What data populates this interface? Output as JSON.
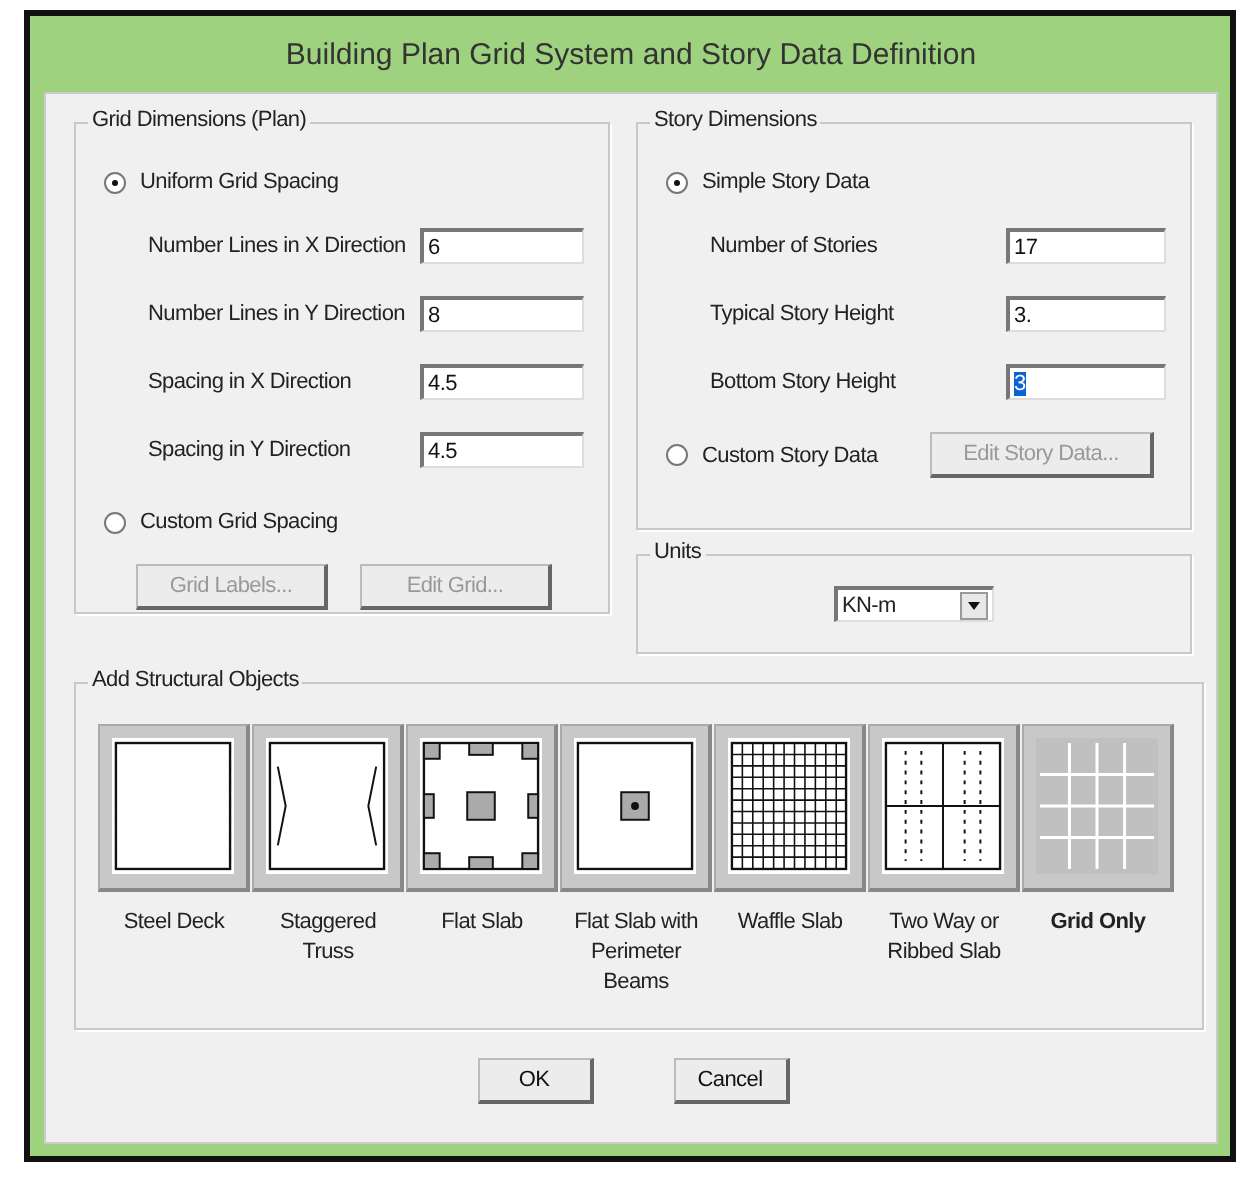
{
  "window": {
    "title": "Building Plan Grid System and Story Data Definition"
  },
  "grid_dimensions": {
    "title": "Grid Dimensions (Plan)",
    "options": [
      {
        "label": "Uniform Grid Spacing",
        "selected": true
      },
      {
        "label": "Custom Grid Spacing",
        "selected": false
      }
    ],
    "fields": [
      {
        "label": "Number Lines in X Direction",
        "value": "6",
        "text_selected": false
      },
      {
        "label": "Number Lines in Y Direction",
        "value": "8",
        "text_selected": false
      },
      {
        "label": "Spacing in X Direction",
        "value": "4.5",
        "text_selected": false
      },
      {
        "label": "Spacing in Y Direction",
        "value": "4.5",
        "text_selected": false
      }
    ],
    "buttons": [
      {
        "label": "Grid Labels...",
        "disabled": true
      },
      {
        "label": "Edit Grid...",
        "disabled": true
      }
    ]
  },
  "story_dimensions": {
    "title": "Story Dimensions",
    "options": [
      {
        "label": "Simple Story Data",
        "selected": true
      },
      {
        "label": "Custom Story Data",
        "selected": false
      }
    ],
    "fields": [
      {
        "label": "Number of Stories",
        "value": "17",
        "text_selected": false
      },
      {
        "label": "Typical Story Height",
        "value": "3.",
        "text_selected": false
      },
      {
        "label": "Bottom Story Height",
        "value": "3",
        "text_selected": true
      }
    ],
    "button": {
      "label": "Edit Story Data...",
      "disabled": true
    }
  },
  "units": {
    "title": "Units",
    "value": "KN-m"
  },
  "structural_objects": {
    "title": "Add Structural Objects",
    "items": [
      {
        "kind": "steel_deck",
        "label": "Steel Deck",
        "selected": false
      },
      {
        "kind": "staggered_truss",
        "label": "Staggered Truss",
        "selected": false
      },
      {
        "kind": "flat_slab",
        "label": "Flat Slab",
        "selected": false
      },
      {
        "kind": "perimeter_beams",
        "label": "Flat Slab with Perimeter Beams",
        "selected": false
      },
      {
        "kind": "waffle",
        "label": "Waffle Slab",
        "selected": false
      },
      {
        "kind": "two_way",
        "label": "Two Way or Ribbed Slab",
        "selected": false
      },
      {
        "kind": "grid_only",
        "label": "Grid Only",
        "selected": true
      }
    ]
  },
  "buttons": [
    {
      "label": "OK"
    },
    {
      "label": "Cancel"
    }
  ]
}
